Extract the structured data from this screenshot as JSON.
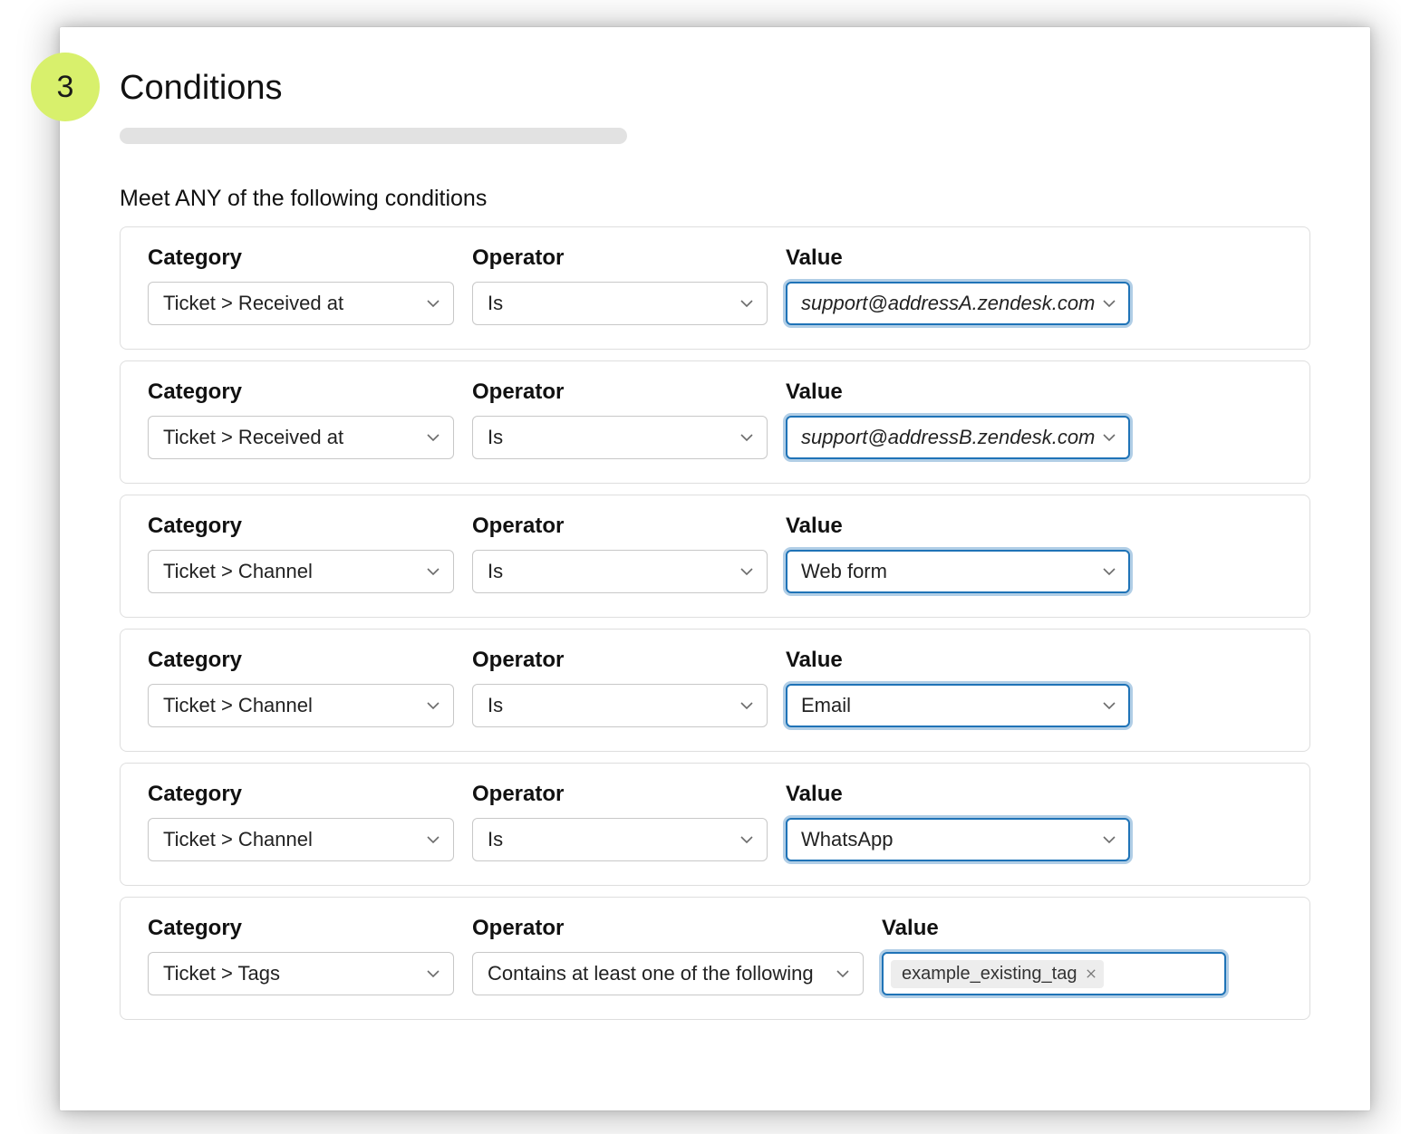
{
  "step_number": "3",
  "heading": "Conditions",
  "subheading": "Meet ANY of the following conditions",
  "labels": {
    "category": "Category",
    "operator": "Operator",
    "value": "Value"
  },
  "rows": [
    {
      "category": "Ticket > Received at",
      "operator": "Is",
      "value": "support@addressA.zendesk.com",
      "value_italic": true,
      "value_type": "select"
    },
    {
      "category": "Ticket > Received at",
      "operator": "Is",
      "value": "support@addressB.zendesk.com",
      "value_italic": true,
      "value_type": "select"
    },
    {
      "category": "Ticket > Channel",
      "operator": "Is",
      "value": "Web form",
      "value_italic": false,
      "value_type": "select"
    },
    {
      "category": "Ticket > Channel",
      "operator": "Is",
      "value": "Email",
      "value_italic": false,
      "value_type": "select"
    },
    {
      "category": "Ticket > Channel",
      "operator": "Is",
      "value": "WhatsApp",
      "value_italic": false,
      "value_type": "select"
    },
    {
      "category": "Ticket > Tags",
      "operator": "Contains at least one of the following",
      "value": "example_existing_tag",
      "value_italic": false,
      "value_type": "tag",
      "op_wide": true
    }
  ]
}
